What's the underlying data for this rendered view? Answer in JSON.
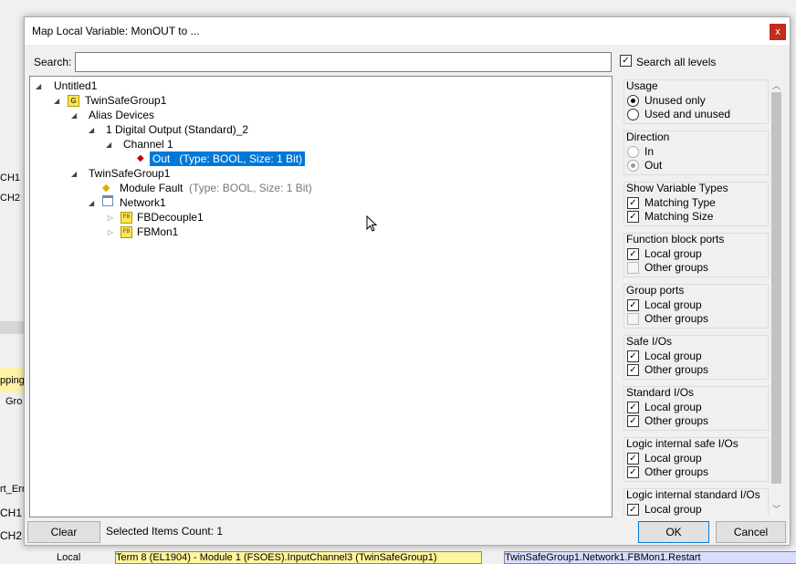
{
  "background": {
    "fragments": [
      "CH1",
      "CH2",
      "pping",
      "Gro",
      "rt_Err",
      "CH1",
      "CH2",
      "Local",
      "Term 8 (EL1904) - Module 1 (FSOES).InputChannel3 (TwinSafeGroup1)",
      "TwinSafeGroup1.Network1.FBMon1.Restart"
    ]
  },
  "dialog": {
    "title": "Map Local Variable: MonOUT to ...",
    "close_glyph": "x",
    "search_label": "Search:",
    "search_value": "",
    "search_all_levels": "Search all levels",
    "tree": {
      "root": "Untitled1",
      "group": "TwinSafeGroup1",
      "group_icon": "G",
      "alias_devices": "Alias Devices",
      "digital_output": "1 Digital Output (Standard)_2",
      "channel": "Channel 1",
      "out_name": "Out",
      "out_type": "(Type: BOOL, Size: 1 Bit)",
      "group2": "TwinSafeGroup1",
      "module_fault": "Module Fault",
      "module_fault_type": "(Type: BOOL, Size: 1 Bit)",
      "network": "Network1",
      "fb_icon": "FB",
      "fb1": "FBDecouple1",
      "fb2": "FBMon1"
    },
    "filters": {
      "usage_title": "Usage",
      "unused_only": "Unused only",
      "used_and_unused": "Used and unused",
      "direction_title": "Direction",
      "dir_in": "In",
      "dir_out": "Out",
      "types_title": "Show Variable Types",
      "matching_type": "Matching Type",
      "matching_size": "Matching Size",
      "fb_ports_title": "Function block ports",
      "group_ports_title": "Group ports",
      "safe_io_title": "Safe I/Os",
      "std_io_title": "Standard I/Os",
      "logic_safe_title": "Logic internal safe I/Os",
      "logic_std_title": "Logic internal standard I/Os",
      "local_group": "Local group",
      "other_groups": "Other groups",
      "check": "✓"
    },
    "clear_label": "Clear",
    "selected_count": "Selected Items Count: 1",
    "ok_label": "OK",
    "cancel_label": "Cancel"
  }
}
